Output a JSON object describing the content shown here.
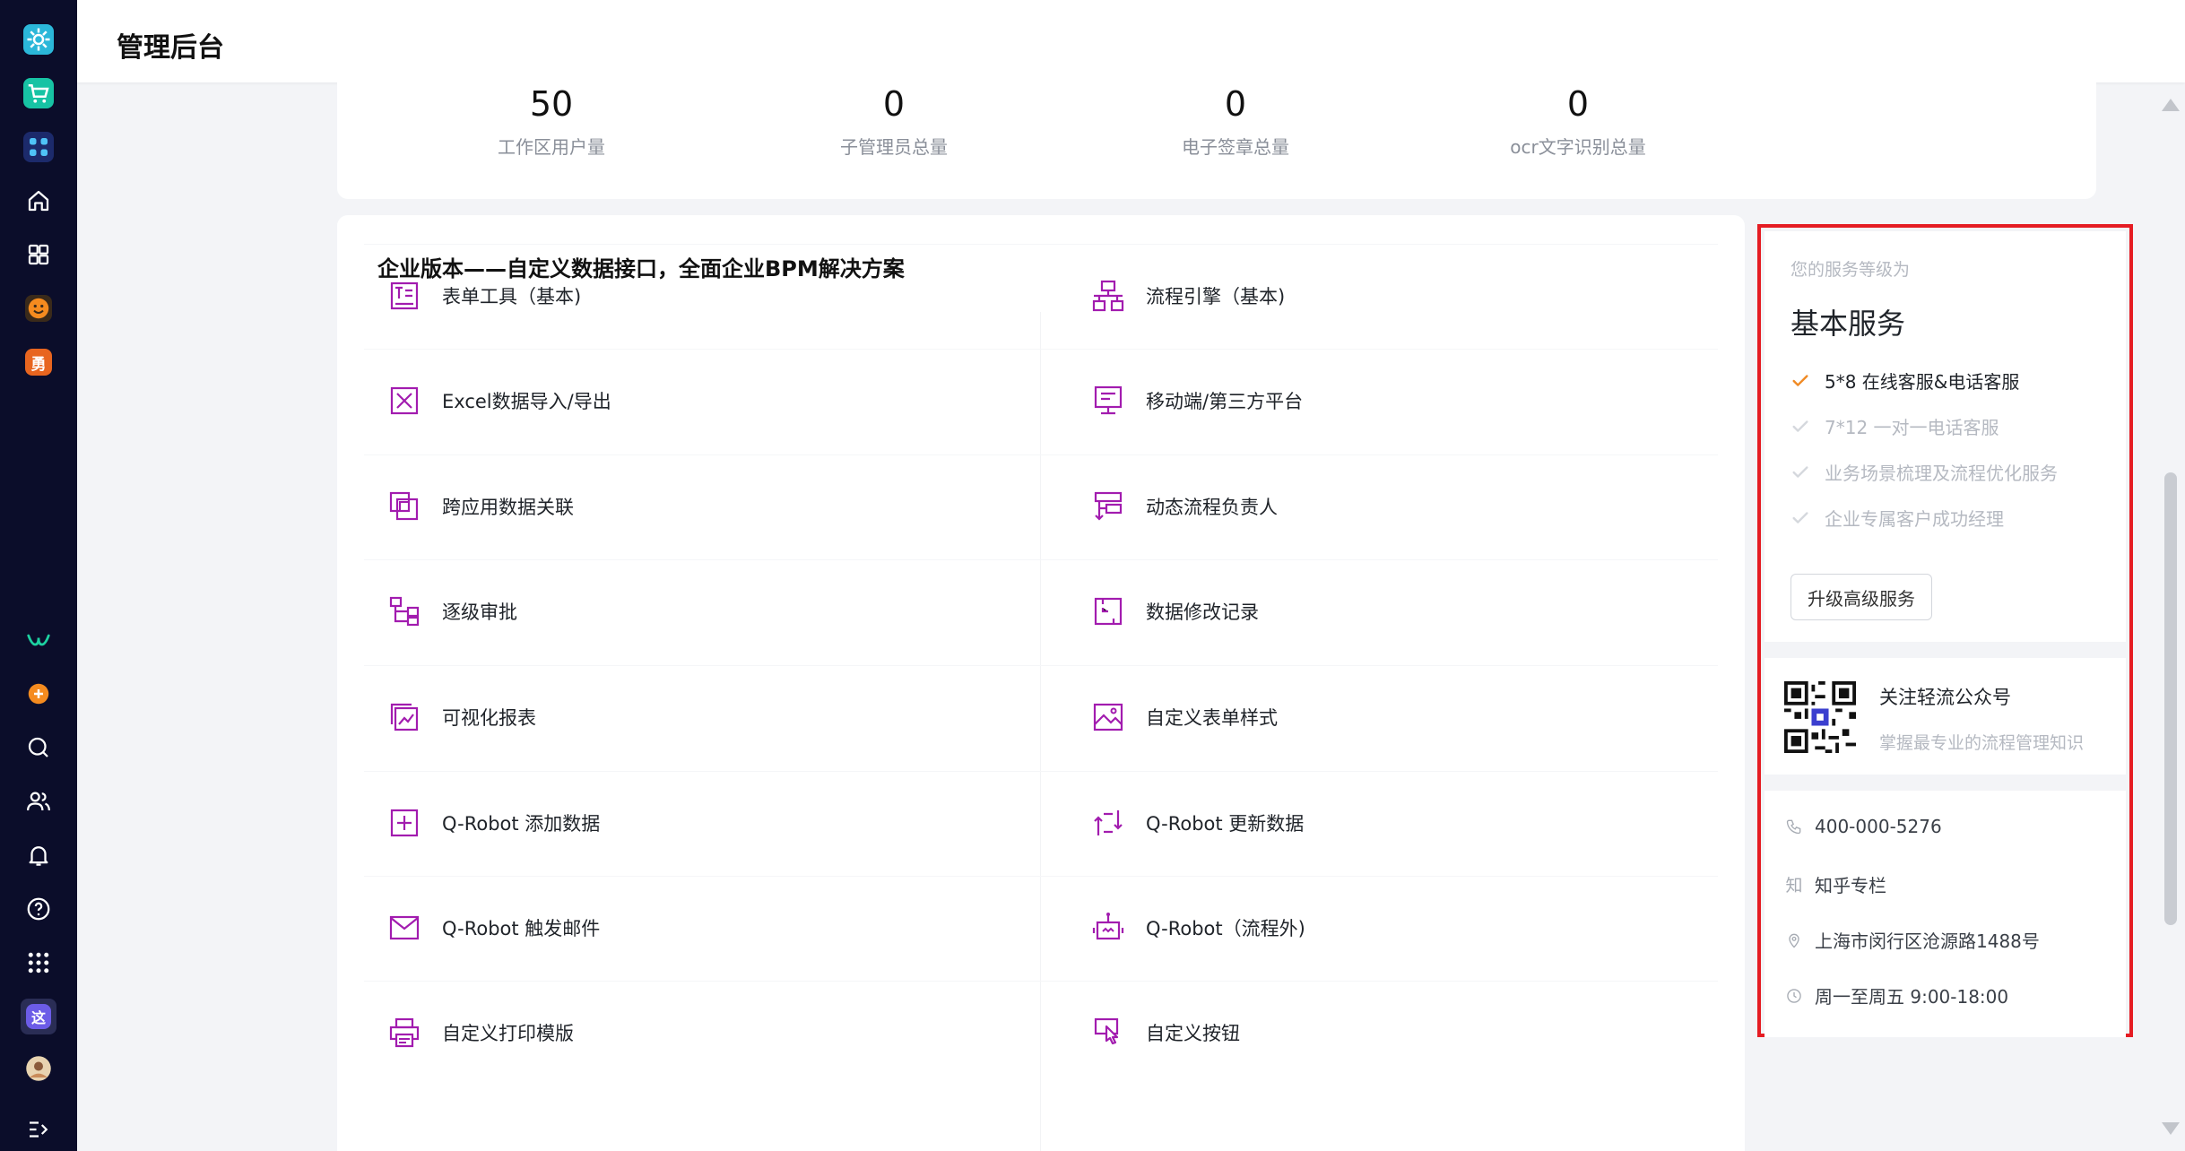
{
  "header": {
    "title": "管理后台"
  },
  "stats": [
    {
      "value": "50",
      "label": "工作区用户量"
    },
    {
      "value": "0",
      "label": "子管理员总量"
    },
    {
      "value": "0",
      "label": "电子签章总量"
    },
    {
      "value": "0",
      "label": "ocr文字识别总量"
    }
  ],
  "main": {
    "title": "企业版本——自定义数据接口，全面企业BPM解决方案",
    "features_left": [
      {
        "label": "表单工具（基本)",
        "icon": "form-tool-icon"
      },
      {
        "label": "Excel数据导入/导出",
        "icon": "excel-icon"
      },
      {
        "label": "跨应用数据关联",
        "icon": "cross-app-icon"
      },
      {
        "label": "逐级审批",
        "icon": "hierarchy-approval-icon"
      },
      {
        "label": "可视化报表",
        "icon": "chart-report-icon"
      },
      {
        "label": "Q-Robot 添加数据",
        "icon": "add-data-icon"
      },
      {
        "label": "Q-Robot 触发邮件",
        "icon": "mail-icon"
      },
      {
        "label": "自定义打印模版",
        "icon": "printer-icon"
      }
    ],
    "features_right": [
      {
        "label": "流程引擎（基本)",
        "icon": "flow-engine-icon"
      },
      {
        "label": "移动端/第三方平台",
        "icon": "mobile-platform-icon"
      },
      {
        "label": "动态流程负责人",
        "icon": "dynamic-owner-icon"
      },
      {
        "label": "数据修改记录",
        "icon": "change-log-icon"
      },
      {
        "label": "自定义表单样式",
        "icon": "image-style-icon"
      },
      {
        "label": "Q-Robot 更新数据",
        "icon": "update-data-icon"
      },
      {
        "label": "Q-Robot（流程外)",
        "icon": "robot-icon"
      },
      {
        "label": "自定义按钮",
        "icon": "custom-button-icon"
      }
    ]
  },
  "service": {
    "subtitle": "您的服务等级为",
    "level": "基本服务",
    "items": [
      {
        "label": "5*8 在线客服&电话客服",
        "active": true
      },
      {
        "label": "7*12 一对一电话客服",
        "active": false
      },
      {
        "label": "业务场景梳理及流程优化服务",
        "active": false
      },
      {
        "label": "企业专属客户成功经理",
        "active": false
      }
    ],
    "upgrade_label": "升级高级服务"
  },
  "wechat": {
    "title": "关注轻流公众号",
    "subtitle": "掌握最专业的流程管理知识"
  },
  "contact": {
    "phone": "400-000-5276",
    "zhihu_glyph": "知",
    "zhihu": "知乎专栏",
    "address": "上海市闵行区沧源路1488号",
    "hours": "周一至周五 9:00-18:00"
  },
  "rail": {
    "app_badge_zhe": "这",
    "app_badge_yong": "勇"
  },
  "colors": {
    "accent_purple": "#a21caf",
    "check_orange": "#f08a24",
    "highlight_red": "#e51c23",
    "rail_bg": "#0b0d2a"
  }
}
